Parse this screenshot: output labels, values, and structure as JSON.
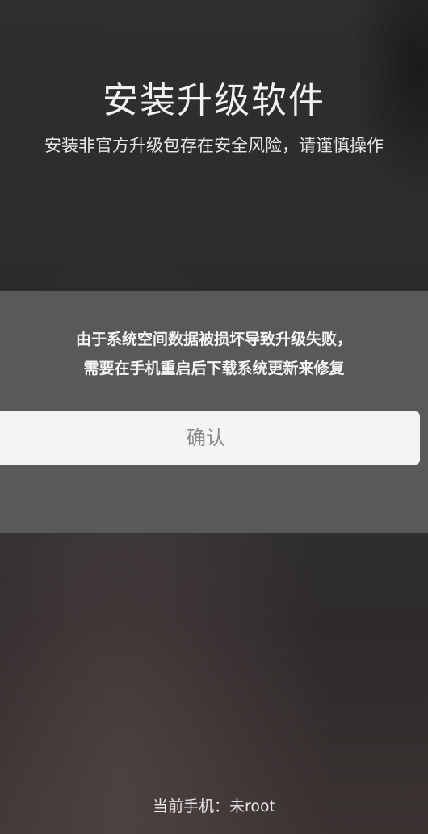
{
  "screen": {
    "title": "安装升级软件",
    "subtitle": "安装非官方升级包存在安全风险，请谨慎操作"
  },
  "dialog": {
    "message_line1": "由于系统空间数据被损坏导致升级失败，",
    "message_line2": "需要在手机重启后下载系统更新来修复",
    "confirm_label": "确认"
  },
  "footer": {
    "root_status": "当前手机：未root"
  },
  "colors": {
    "background": "#2c2c2c",
    "dialog": "#5a5959",
    "button": "#f4f4f4",
    "button_text": "#8a8a8a"
  }
}
